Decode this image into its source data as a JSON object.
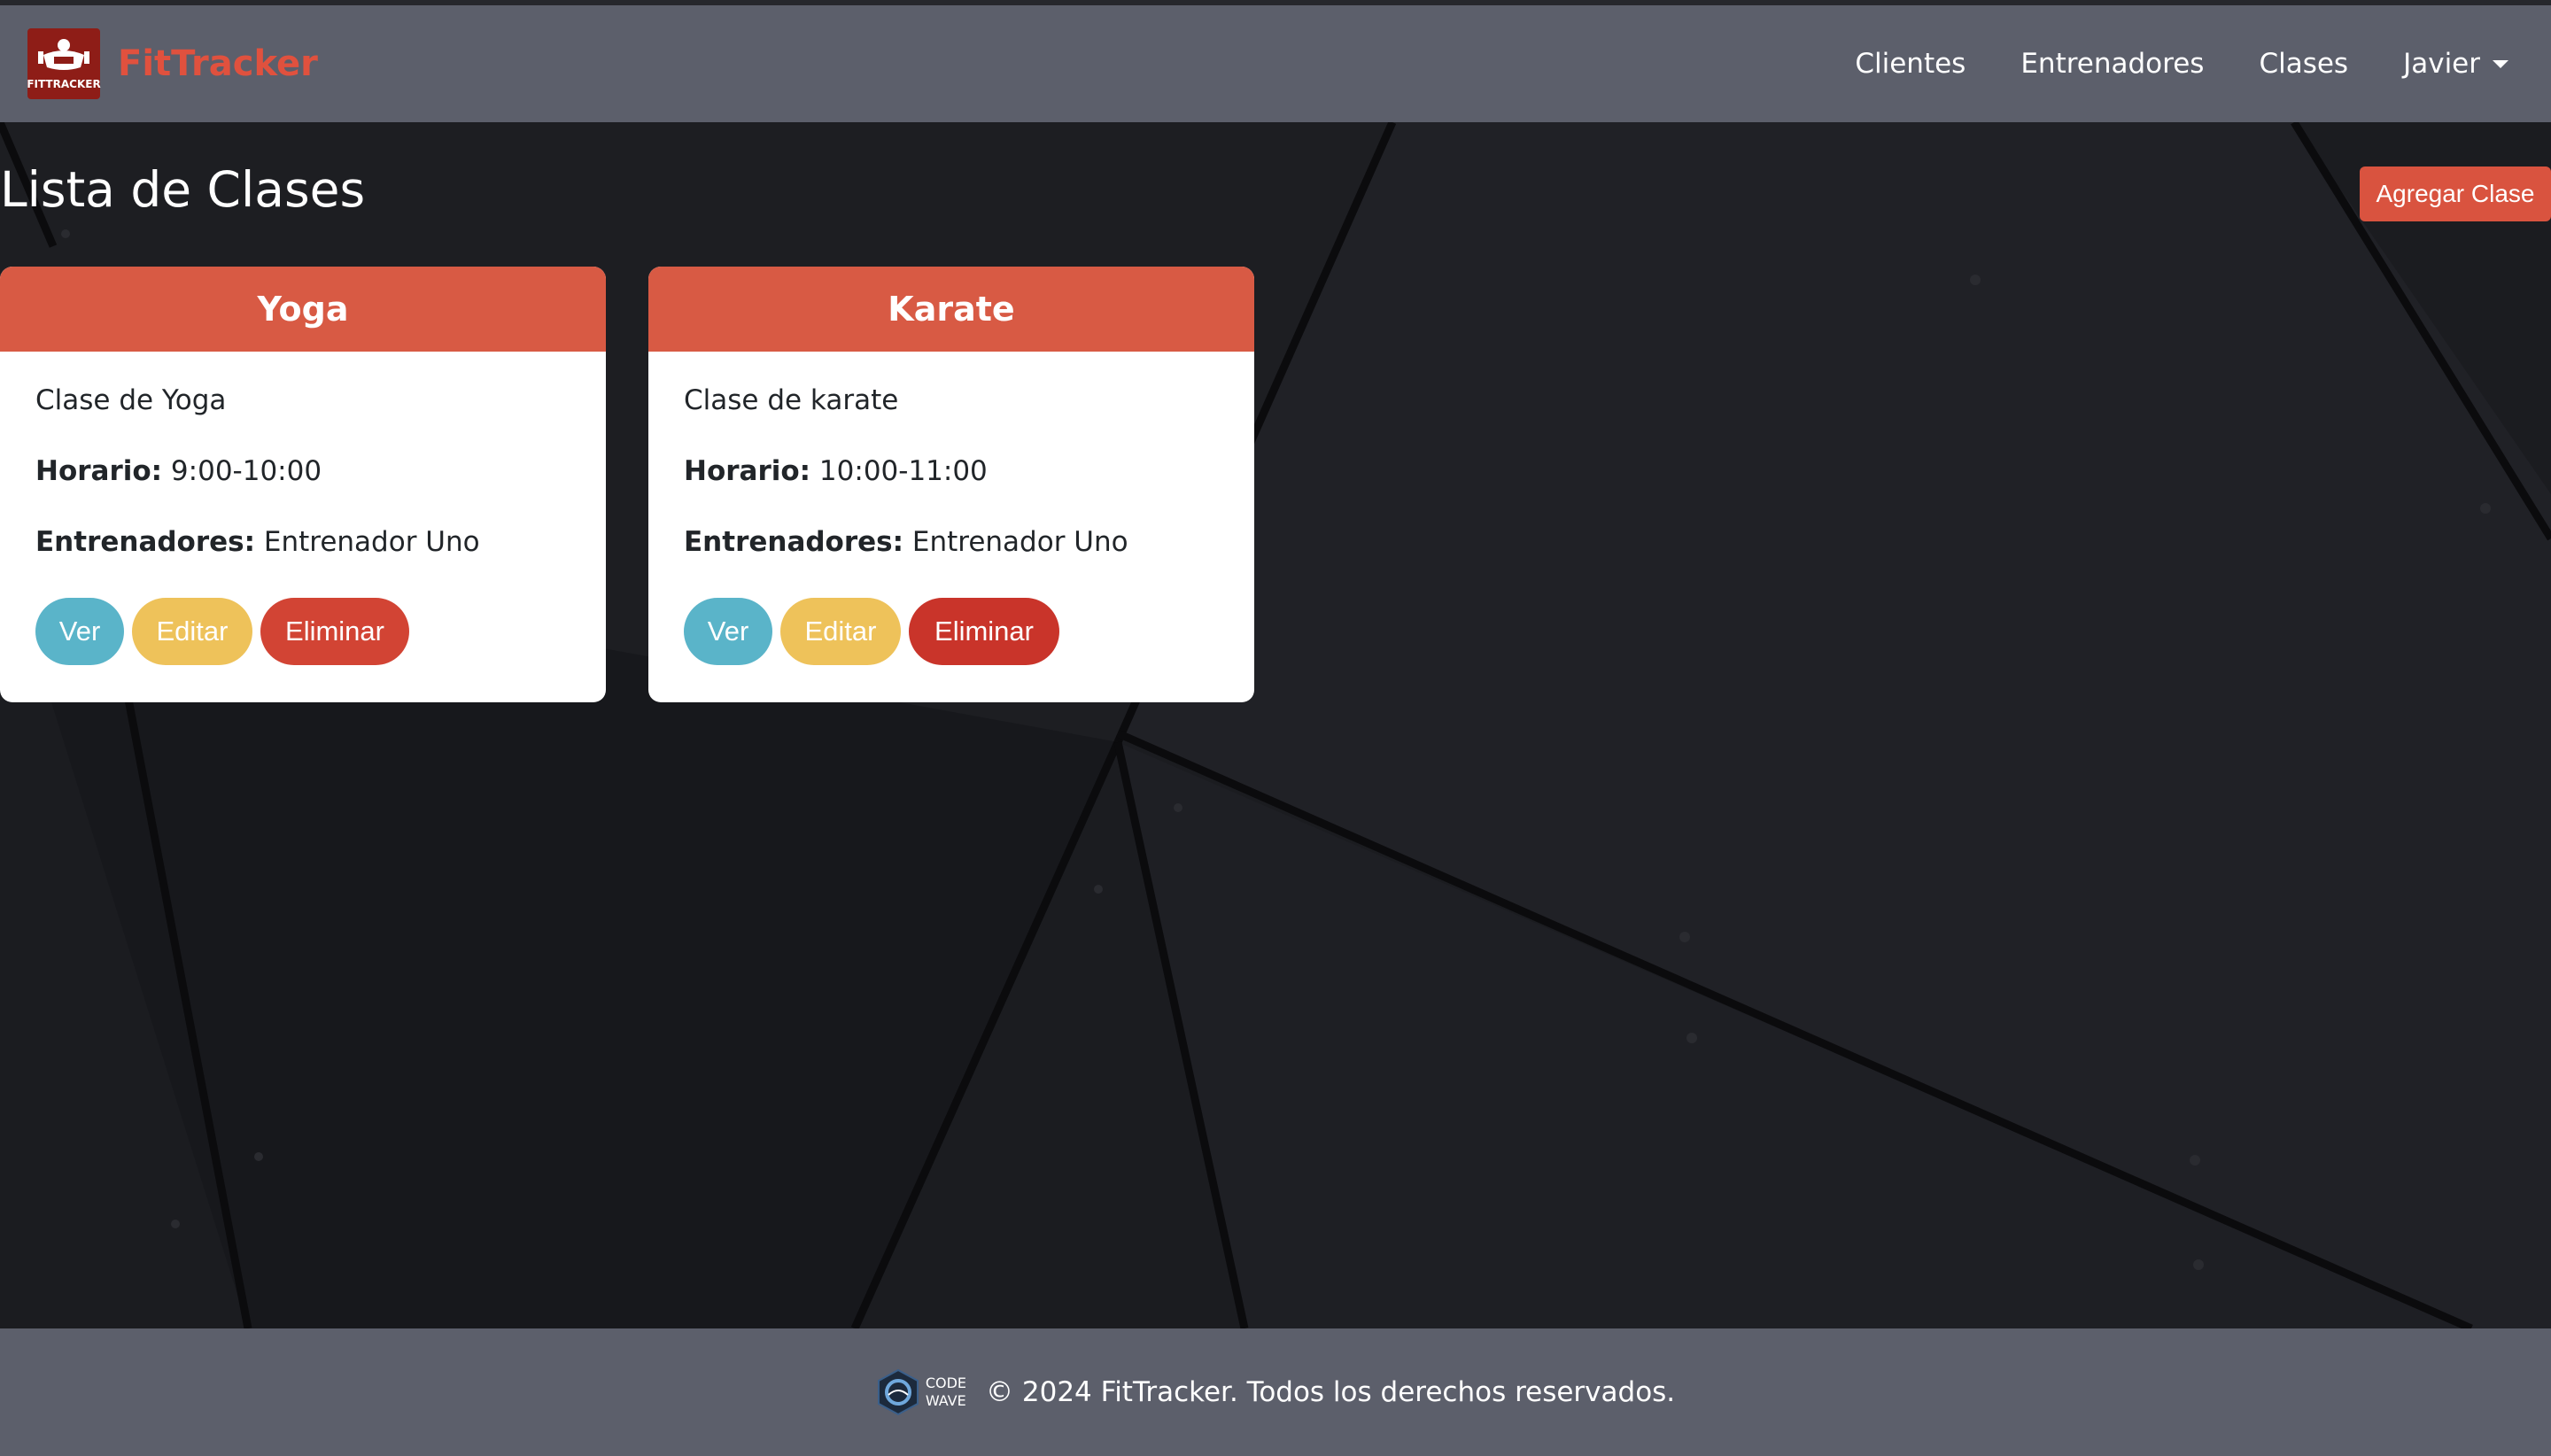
{
  "brand": {
    "name": "FitTracker",
    "logo_text": "FITTRACKER"
  },
  "nav": {
    "clientes": "Clientes",
    "entrenadores": "Entrenadores",
    "clases": "Clases",
    "user": "Javier"
  },
  "page": {
    "title": "Lista de Clases",
    "add_label": "Agregar Clase"
  },
  "labels": {
    "horario": "Horario:",
    "entrenadores": "Entrenadores:",
    "ver": "Ver",
    "editar": "Editar",
    "eliminar": "Eliminar"
  },
  "classes": [
    {
      "name": "Yoga",
      "description": "Clase de Yoga",
      "schedule": "9:00-10:00",
      "trainers": "Entrenador Uno"
    },
    {
      "name": "Karate",
      "description": "Clase de karate",
      "schedule": "10:00-11:00",
      "trainers": "Entrenador Uno"
    }
  ],
  "footer": {
    "logo_top": "CODE",
    "logo_bottom": "WAVE",
    "text": "© 2024 FitTracker. Todos los derechos reservados."
  },
  "colors": {
    "navbar": "#5c5f6b",
    "accent": "#d85a44",
    "background": "#1a1b1f"
  }
}
